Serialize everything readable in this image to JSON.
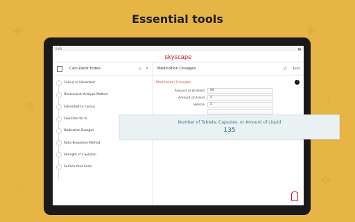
{
  "headline": "Essential tools",
  "app": {
    "status_time": "9:00",
    "brand": "skyscape",
    "left_title": "Calculator Index",
    "right_title": "Medication Dosages",
    "find_label": "Find"
  },
  "calculators": [
    "Celsius to Fahrenheit",
    "Dimensional Analysis Method",
    "Fahrenheit to Celsius",
    "Flow Rate for IV",
    "Medication Dosages",
    "Ratio-Proportion Method",
    "Strength of a Solution",
    "Surface Area Scale"
  ],
  "form": {
    "section_title": "Medication Dosages",
    "fields": [
      {
        "label": "Amount of Ordered",
        "value": "90"
      },
      {
        "label": "Amount on Hand",
        "value": "4"
      },
      {
        "label": "Vehicle",
        "value": "5"
      },
      {
        "label": "",
        "value": ""
      }
    ]
  },
  "result": {
    "question": "Number of Tablets, Capsules, or Amount of Liquid",
    "answer": "135"
  },
  "colors": {
    "background": "#E7B446",
    "brand": "#C8172A",
    "result_bg": "#E9F1F2",
    "result_text": "#2C7A86"
  }
}
